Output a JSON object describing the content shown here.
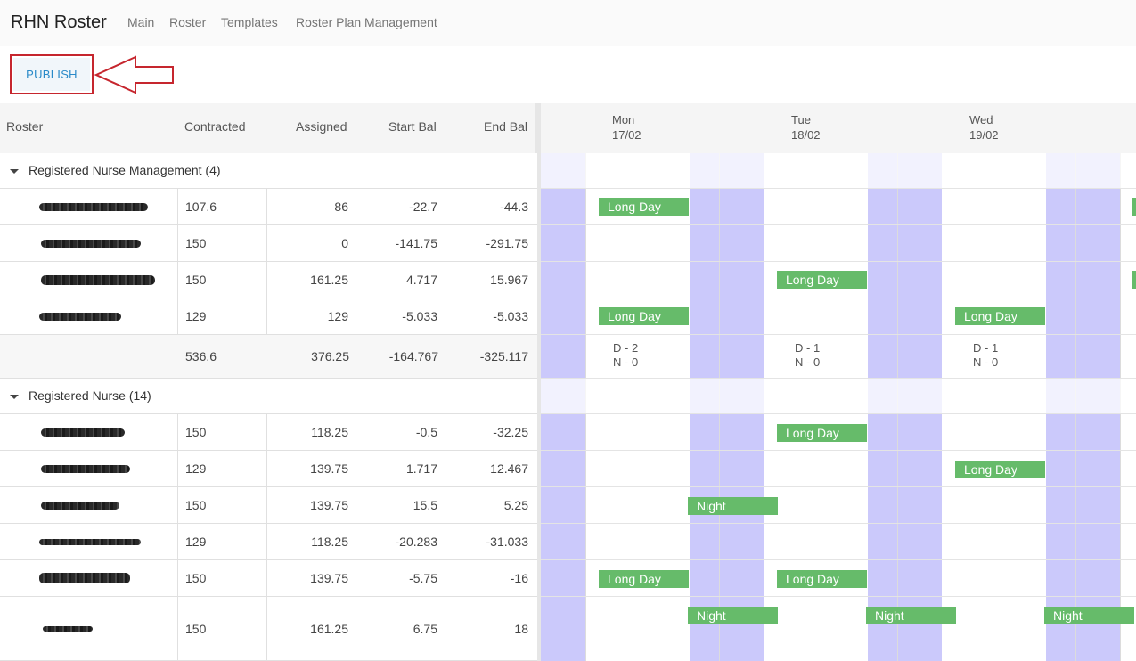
{
  "app": {
    "title": "RHN Roster",
    "nav": [
      "Main",
      "Roster",
      "Templates",
      "Roster Plan Management"
    ]
  },
  "toolbar": {
    "publish_label": "PUBLISH"
  },
  "columns": {
    "roster": "Roster",
    "contracted": "Contracted",
    "assigned": "Assigned",
    "start_bal": "Start Bal",
    "end_bal": "End Bal"
  },
  "days": [
    {
      "name": "Mon",
      "date": "17/02"
    },
    {
      "name": "Tue",
      "date": "18/02"
    },
    {
      "name": "Wed",
      "date": "19/02"
    }
  ],
  "groups": [
    {
      "label": "Registered Nurse Management (4)",
      "rows": [
        {
          "contracted": "107.6",
          "assigned": "86",
          "start_bal": "-22.7",
          "end_bal": "-44.3"
        },
        {
          "contracted": "150",
          "assigned": "0",
          "start_bal": "-141.75",
          "end_bal": "-291.75"
        },
        {
          "contracted": "150",
          "assigned": "161.25",
          "start_bal": "4.717",
          "end_bal": "15.967"
        },
        {
          "contracted": "129",
          "assigned": "129",
          "start_bal": "-5.033",
          "end_bal": "-5.033"
        }
      ],
      "totals": {
        "contracted": "536.6",
        "assigned": "376.25",
        "start_bal": "-164.767",
        "end_bal": "-325.117"
      },
      "day_counts": [
        {
          "d": "D - 2",
          "n": "N - 0"
        },
        {
          "d": "D - 1",
          "n": "N - 0"
        },
        {
          "d": "D - 1",
          "n": "N - 0"
        }
      ]
    },
    {
      "label": "Registered Nurse (14)",
      "rows": [
        {
          "contracted": "150",
          "assigned": "118.25",
          "start_bal": "-0.5",
          "end_bal": "-32.25"
        },
        {
          "contracted": "129",
          "assigned": "139.75",
          "start_bal": "1.717",
          "end_bal": "12.467"
        },
        {
          "contracted": "150",
          "assigned": "139.75",
          "start_bal": "15.5",
          "end_bal": "5.25"
        },
        {
          "contracted": "129",
          "assigned": "118.25",
          "start_bal": "-20.283",
          "end_bal": "-31.033"
        },
        {
          "contracted": "150",
          "assigned": "139.75",
          "start_bal": "-5.75",
          "end_bal": "-16"
        },
        {
          "contracted": "150",
          "assigned": "161.25",
          "start_bal": "6.75",
          "end_bal": "18"
        }
      ]
    }
  ],
  "shifts": {
    "long_day": "Long Day",
    "night": "Night"
  },
  "colors": {
    "shift": "#66bb6a",
    "weekend_band": "#cbc9fb",
    "publish_text": "#2a8ac8",
    "highlight": "#c6262e"
  }
}
